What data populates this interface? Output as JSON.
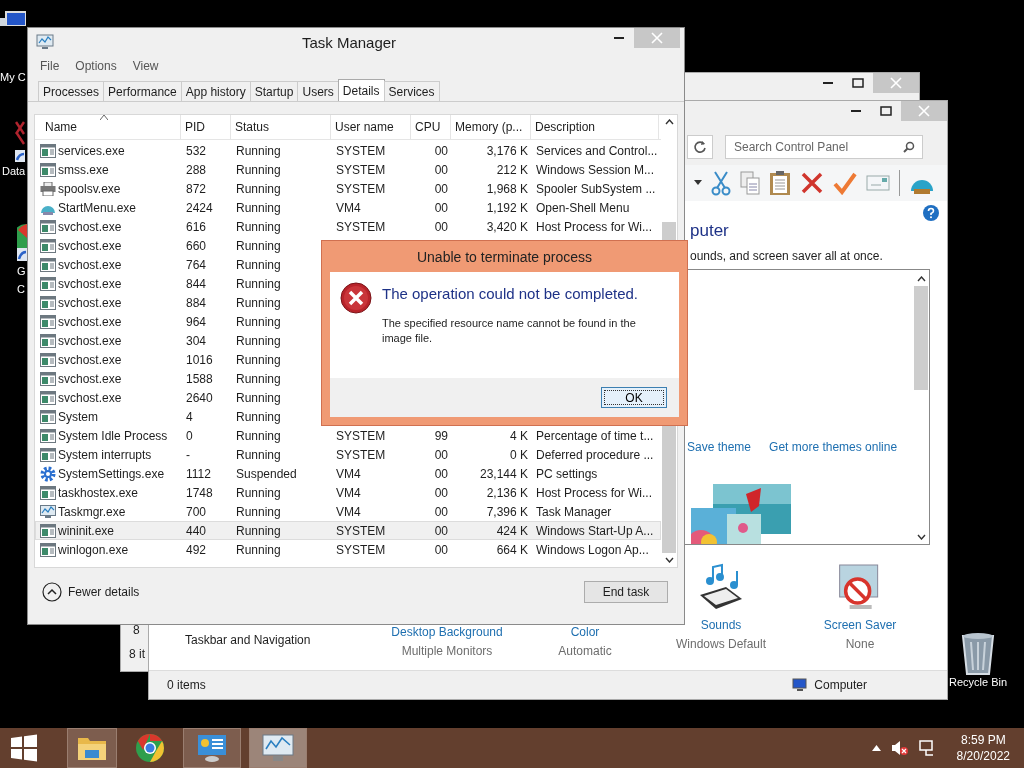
{
  "desktop": {
    "icons": [
      {
        "kind": "computer",
        "label": "My C"
      },
      {
        "kind": "database",
        "label": "Data"
      },
      {
        "kind": "chrome",
        "label": "G C"
      }
    ],
    "recycle_bin": {
      "label": "Recycle Bin"
    }
  },
  "back_window": {
    "status_items": [
      "8",
      "8 it"
    ]
  },
  "control_panel": {
    "search": {
      "placeholder": "Search Control Panel"
    },
    "heading": "puter",
    "description": "ounds, and screen saver all at once.",
    "theme_links": [
      "Save theme",
      "Get more themes online"
    ],
    "bottom_items": [
      {
        "kind": "text",
        "title": "Taskbar and Navigation"
      },
      {
        "kind": "link",
        "title": "Desktop Background",
        "subtitle": "Multiple Monitors"
      },
      {
        "kind": "link",
        "title": "Color",
        "subtitle": "Automatic"
      },
      {
        "kind": "sounds",
        "title": "Sounds",
        "subtitle": "Windows Default"
      },
      {
        "kind": "saver",
        "title": "Screen Saver",
        "subtitle": "None"
      }
    ],
    "status_bar": {
      "items": "0 items",
      "location": "Computer"
    }
  },
  "task_manager": {
    "title": "Task Manager",
    "menu": [
      "File",
      "Options",
      "View"
    ],
    "tabs": [
      {
        "label": "Processes",
        "selected": false
      },
      {
        "label": "Performance",
        "selected": false
      },
      {
        "label": "App history",
        "selected": false
      },
      {
        "label": "Startup",
        "selected": false
      },
      {
        "label": "Users",
        "selected": false
      },
      {
        "label": "Details",
        "selected": true
      },
      {
        "label": "Services",
        "selected": false
      }
    ],
    "columns": [
      "Name",
      "PID",
      "Status",
      "User name",
      "CPU",
      "Memory (p...",
      "Description"
    ],
    "rows": [
      {
        "kind": "app",
        "name": "services.exe",
        "pid": "532",
        "status": "Running",
        "user": "SYSTEM",
        "cpu": "00",
        "memory": "3,176 K",
        "description": "Services and Control...",
        "selected": false
      },
      {
        "kind": "app",
        "name": "smss.exe",
        "pid": "288",
        "status": "Running",
        "user": "SYSTEM",
        "cpu": "00",
        "memory": "212 K",
        "description": "Windows Session M...",
        "selected": false
      },
      {
        "kind": "printer",
        "name": "spoolsv.exe",
        "pid": "872",
        "status": "Running",
        "user": "SYSTEM",
        "cpu": "00",
        "memory": "1,968 K",
        "description": "Spooler SubSystem ...",
        "selected": false
      },
      {
        "kind": "shell",
        "name": "StartMenu.exe",
        "pid": "2424",
        "status": "Running",
        "user": "VM4",
        "cpu": "00",
        "memory": "1,192 K",
        "description": "Open-Shell Menu",
        "selected": false
      },
      {
        "kind": "app",
        "name": "svchost.exe",
        "pid": "616",
        "status": "Running",
        "user": "SYSTEM",
        "cpu": "00",
        "memory": "3,420 K",
        "description": "Host Process for Wi...",
        "selected": false
      },
      {
        "kind": "app",
        "name": "svchost.exe",
        "pid": "660",
        "status": "Running",
        "selected": false
      },
      {
        "kind": "app",
        "name": "svchost.exe",
        "pid": "764",
        "status": "Running",
        "selected": false
      },
      {
        "kind": "app",
        "name": "svchost.exe",
        "pid": "844",
        "status": "Running",
        "selected": false
      },
      {
        "kind": "app",
        "name": "svchost.exe",
        "pid": "884",
        "status": "Running",
        "selected": false
      },
      {
        "kind": "app",
        "name": "svchost.exe",
        "pid": "964",
        "status": "Running",
        "selected": false
      },
      {
        "kind": "app",
        "name": "svchost.exe",
        "pid": "304",
        "status": "Running",
        "selected": false
      },
      {
        "kind": "app",
        "name": "svchost.exe",
        "pid": "1016",
        "status": "Running",
        "selected": false
      },
      {
        "kind": "app",
        "name": "svchost.exe",
        "pid": "1588",
        "status": "Running",
        "selected": false
      },
      {
        "kind": "app",
        "name": "svchost.exe",
        "pid": "2640",
        "status": "Running",
        "selected": false
      },
      {
        "kind": "app",
        "name": "System",
        "pid": "4",
        "status": "Running",
        "selected": false
      },
      {
        "kind": "app",
        "name": "System Idle Process",
        "pid": "0",
        "status": "Running",
        "user": "SYSTEM",
        "cpu": "99",
        "memory": "4 K",
        "description": "Percentage of time t...",
        "selected": false
      },
      {
        "kind": "app",
        "name": "System interrupts",
        "pid": "-",
        "status": "Running",
        "user": "SYSTEM",
        "cpu": "00",
        "memory": "0 K",
        "description": "Deferred procedure ...",
        "selected": false
      },
      {
        "kind": "gear",
        "name": "SystemSettings.exe",
        "pid": "1112",
        "status": "Suspended",
        "user": "VM4",
        "cpu": "00",
        "memory": "23,144 K",
        "description": "PC settings",
        "selected": false
      },
      {
        "kind": "app",
        "name": "taskhostex.exe",
        "pid": "1748",
        "status": "Running",
        "user": "VM4",
        "cpu": "00",
        "memory": "2,136 K",
        "description": "Host Process for Wi...",
        "selected": false
      },
      {
        "kind": "monitor",
        "name": "Taskmgr.exe",
        "pid": "700",
        "status": "Running",
        "user": "VM4",
        "cpu": "00",
        "memory": "7,396 K",
        "description": "Task Manager",
        "selected": false
      },
      {
        "kind": "app",
        "name": "wininit.exe",
        "pid": "440",
        "status": "Running",
        "user": "SYSTEM",
        "cpu": "00",
        "memory": "424 K",
        "description": "Windows Start-Up A...",
        "selected": true
      },
      {
        "kind": "app",
        "name": "winlogon.exe",
        "pid": "492",
        "status": "Running",
        "user": "SYSTEM",
        "cpu": "00",
        "memory": "664 K",
        "description": "Windows Logon Ap...",
        "selected": false
      }
    ],
    "fewer_details": "Fewer details",
    "end_task": "End task"
  },
  "dialog": {
    "title": "Unable to terminate process",
    "heading": "The operation could not be completed.",
    "message": "The specified resource name cannot be found in the image file.",
    "button": "OK"
  },
  "taskbar": {
    "apps": [
      {
        "kind": "explorer",
        "selected": true
      },
      {
        "kind": "chrome",
        "selected": false
      },
      {
        "kind": "control",
        "selected": true
      },
      {
        "kind": "taskmgr",
        "selected": true
      }
    ],
    "time": "8:59 PM",
    "date": "8/20/2022"
  }
}
